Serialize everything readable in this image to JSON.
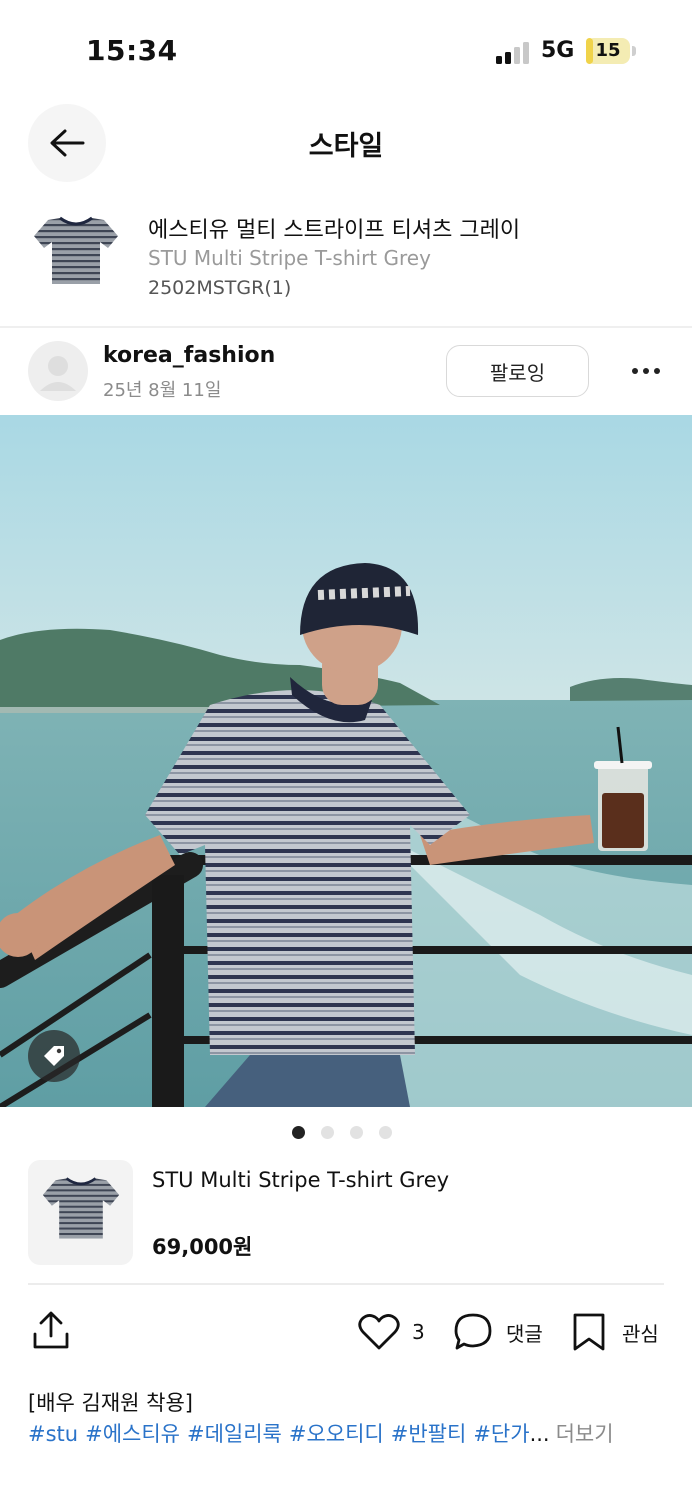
{
  "status": {
    "time": "15:34",
    "network": "5G",
    "battery": "15",
    "battery_fraction": 0.15
  },
  "header": {
    "title": "스타일"
  },
  "product": {
    "name_ko": "에스티유 멀티 스트라이프 티셔츠 그레이",
    "name_en": "STU Multi Stripe T-shirt Grey",
    "code": "2502MSTGR(1)"
  },
  "post": {
    "username": "korea_fashion",
    "date": "25년 8월 11일",
    "follow_label": "팔로잉"
  },
  "pager": {
    "count": 4,
    "active_index": 0
  },
  "card": {
    "name": "STU Multi Stripe T-shirt Grey",
    "price": "69,000원"
  },
  "actions": {
    "like_count": "3",
    "comment_label": "댓글",
    "bookmark_label": "관심"
  },
  "caption": {
    "text": "[배우 김재원 착용]",
    "hashtags": [
      "#stu",
      "#에스티유",
      "#데일리룩",
      "#오오티디",
      "#반팔티",
      "#단가"
    ],
    "ellipsis": "...",
    "more_label": "더보기"
  }
}
